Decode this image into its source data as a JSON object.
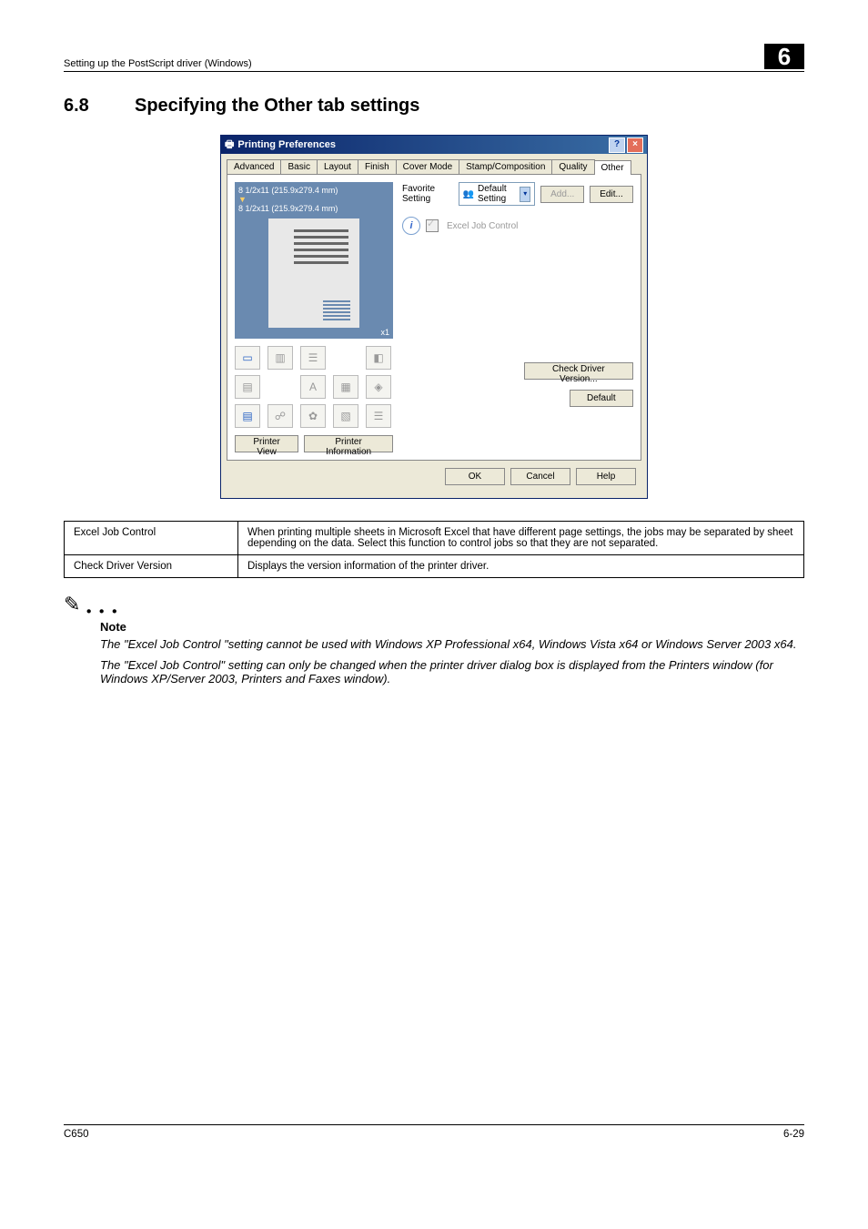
{
  "header": {
    "path": "Setting up the PostScript driver (Windows)",
    "chapter": "6"
  },
  "section": {
    "number": "6.8",
    "title": "Specifying the Other tab settings"
  },
  "dialog": {
    "title": "Printing Preferences",
    "tabs": [
      "Advanced",
      "Basic",
      "Layout",
      "Finish",
      "Cover Mode",
      "Stamp/Composition",
      "Quality",
      "Other"
    ],
    "active_tab": "Other",
    "preview": {
      "size1": "8 1/2x11 (215.9x279.4 mm)",
      "size2": "8 1/2x11 (215.9x279.4 mm)",
      "x1": "x1"
    },
    "left_buttons": {
      "printer_view": "Printer View",
      "printer_info": "Printer Information"
    },
    "favorite": {
      "label": "Favorite Setting",
      "value": "Default Setting",
      "add": "Add...",
      "edit": "Edit..."
    },
    "excel_job_control": "Excel Job Control",
    "check_driver": "Check Driver Version...",
    "default_btn": "Default",
    "footer": {
      "ok": "OK",
      "cancel": "Cancel",
      "help": "Help"
    }
  },
  "table": {
    "rows": [
      {
        "name": "Excel Job Control",
        "desc": "When printing multiple sheets in Microsoft Excel that have different page settings, the jobs may be separated by sheet depending on the data. Select this function to control jobs so that they are not separated."
      },
      {
        "name": "Check Driver Version",
        "desc": "Displays the version information of the printer driver."
      }
    ]
  },
  "note": {
    "label": "Note",
    "p1": "The \"Excel Job Control \"setting cannot be used with Windows XP Professional x64, Windows Vista x64 or Windows Server 2003 x64.",
    "p2": "The \"Excel Job Control\" setting can only be changed when the printer driver dialog box is displayed from the Printers window (for Windows XP/Server 2003, Printers and Faxes window)."
  },
  "footer": {
    "left": "C650",
    "right": "6-29"
  }
}
